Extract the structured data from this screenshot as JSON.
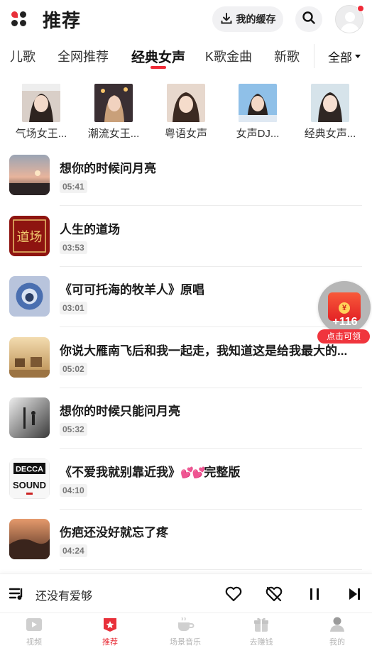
{
  "header": {
    "title": "推荐",
    "cache_label": "我的缓存"
  },
  "tabs": [
    "儿歌",
    "全网推荐",
    "经典女声",
    "K歌金曲",
    "新歌"
  ],
  "active_tab": "经典女声",
  "all_label": "全部",
  "artists": [
    {
      "name": "气场女王..."
    },
    {
      "name": "潮流女王..."
    },
    {
      "name": "粤语女声"
    },
    {
      "name": "女声DJ..."
    },
    {
      "name": "经典女声..."
    }
  ],
  "songs": [
    {
      "title": "想你的时候问月亮",
      "duration": "05:41"
    },
    {
      "title": "人生的道场",
      "duration": "03:53"
    },
    {
      "title": "《可可托海的牧羊人》原唱",
      "duration": "03:01"
    },
    {
      "title": "你说大雁南飞后和我一起走，我知道这是给我最大的...",
      "duration": "05:02"
    },
    {
      "title": "想你的时候只能问月亮",
      "duration": "05:32"
    },
    {
      "title": "《不爱我就别靠近我》",
      "title_suffix": "完整版",
      "duration": "04:10"
    },
    {
      "title": "伤疤还没好就忘了疼",
      "duration": "04:24"
    }
  ],
  "cover_texts": {
    "decca_top": "DECCA",
    "decca_bottom": "SOUND",
    "daochang": "道场"
  },
  "reward": {
    "count": "+116",
    "label": "点击可领"
  },
  "player": {
    "now_playing": "还没有爱够"
  },
  "nav": [
    {
      "label": "视频",
      "icon": "video-icon"
    },
    {
      "label": "推荐",
      "icon": "recommend-icon"
    },
    {
      "label": "场景音乐",
      "icon": "coffee-cup-icon"
    },
    {
      "label": "去赚钱",
      "icon": "gift-icon"
    },
    {
      "label": "我的",
      "icon": "profile-icon"
    }
  ],
  "colors": {
    "accent": "#ef2b37",
    "inactive_nav": "#b5b5b5"
  }
}
